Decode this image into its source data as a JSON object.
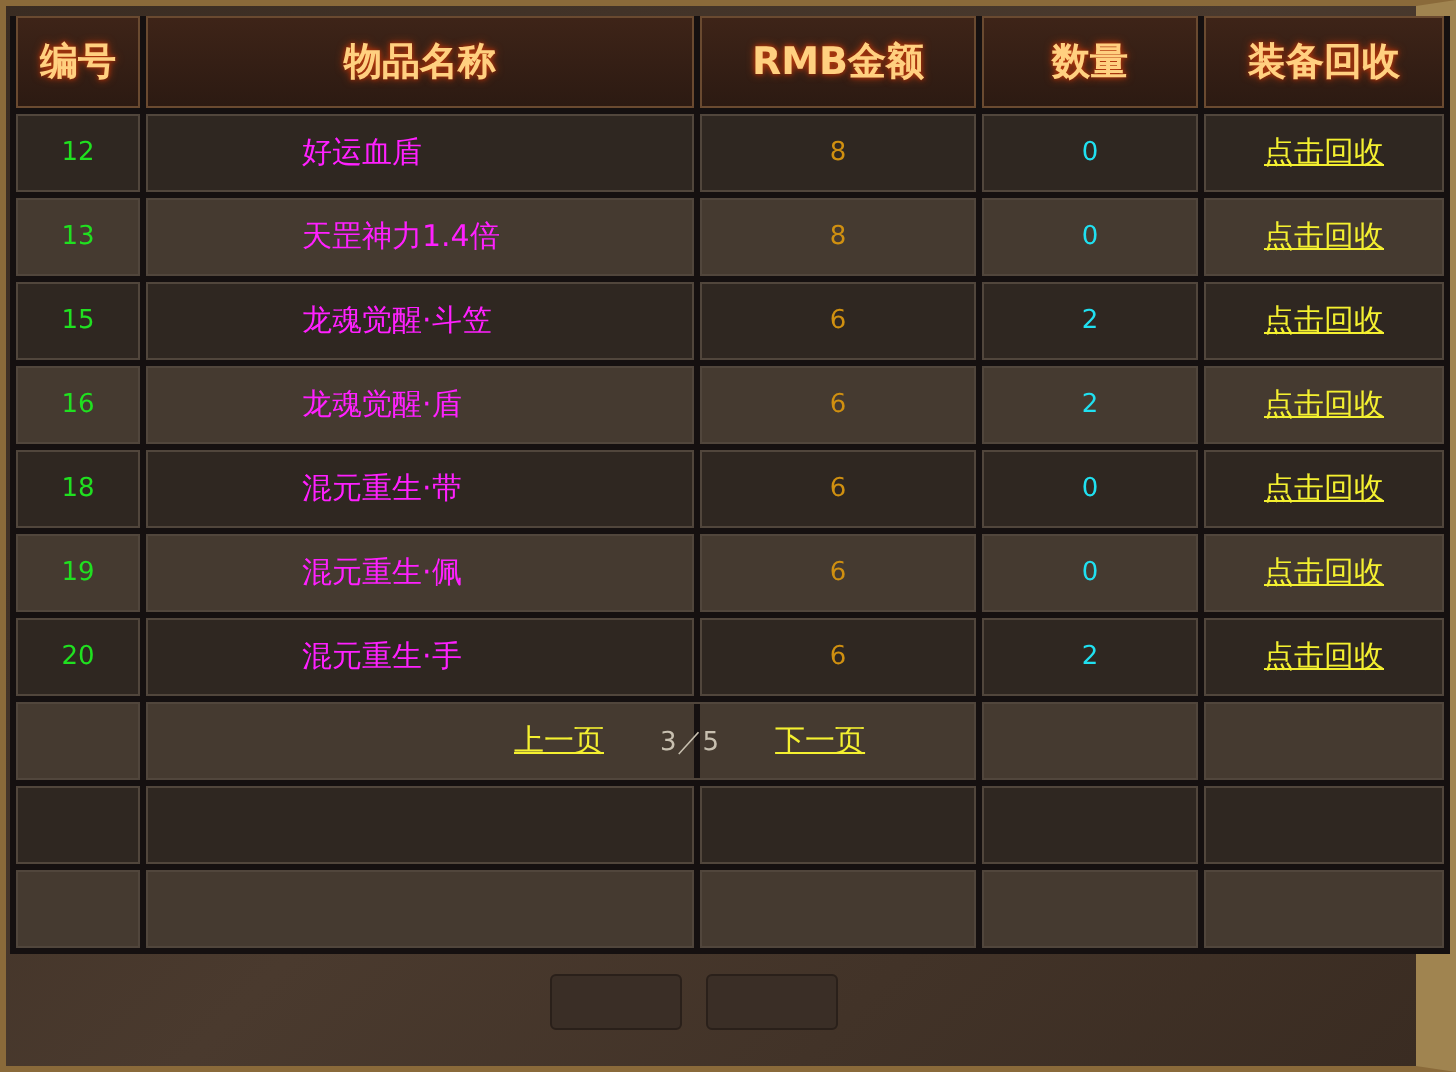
{
  "table": {
    "columns": [
      "编号",
      "物品名称",
      "RMB金额",
      "数量",
      "装备回收"
    ],
    "rows": [
      {
        "id": "12",
        "name": "好运血盾",
        "price": "8",
        "count": "0",
        "action": "点击回收"
      },
      {
        "id": "13",
        "name": "天罡神力1.4倍",
        "price": "8",
        "count": "0",
        "action": "点击回收"
      },
      {
        "id": "15",
        "name": "龙魂觉醒·斗笠",
        "price": "6",
        "count": "2",
        "action": "点击回收"
      },
      {
        "id": "16",
        "name": "龙魂觉醒·盾",
        "price": "6",
        "count": "2",
        "action": "点击回收"
      },
      {
        "id": "18",
        "name": "混元重生·带",
        "price": "6",
        "count": "0",
        "action": "点击回收"
      },
      {
        "id": "19",
        "name": "混元重生·佩",
        "price": "6",
        "count": "0",
        "action": "点击回收"
      },
      {
        "id": "20",
        "name": "混元重生·手",
        "price": "6",
        "count": "2",
        "action": "点击回收"
      }
    ]
  },
  "pagination": {
    "previous": "上一页",
    "page": "3／5",
    "next": "下一页"
  }
}
